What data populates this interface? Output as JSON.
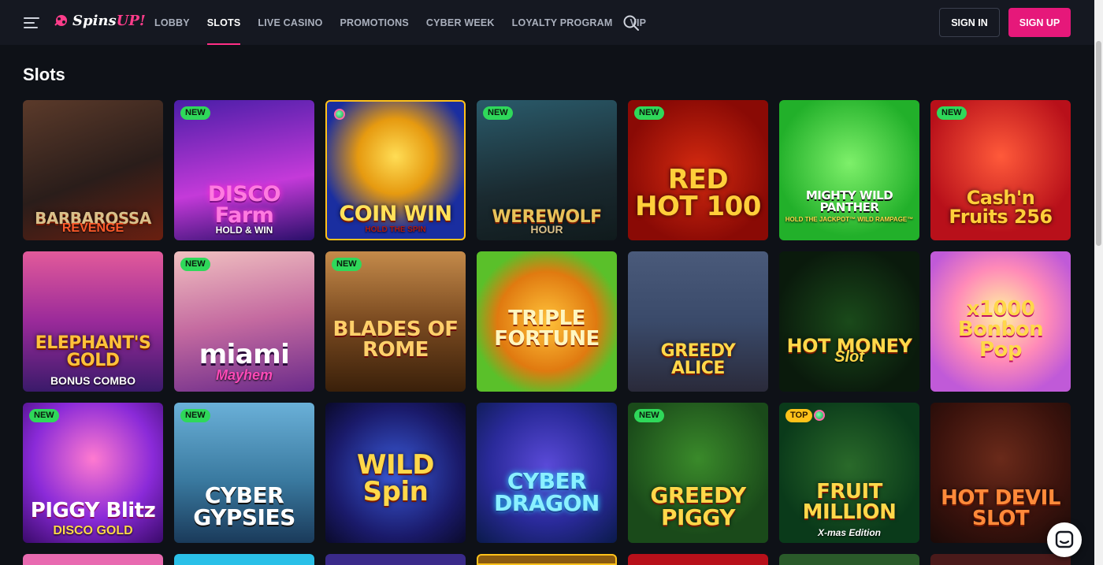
{
  "header": {
    "logo_text": "Spins",
    "logo_accent": "UP!",
    "nav": [
      "LOBBY",
      "SLOTS",
      "LIVE CASINO",
      "PROMOTIONS",
      "CYBER WEEK",
      "LOYALTY PROGRAM",
      "VIP"
    ],
    "active_nav": "SLOTS",
    "signin_label": "SIGN IN",
    "signup_label": "SIGN UP"
  },
  "page": {
    "title": "Slots"
  },
  "games": [
    {
      "name": "BARBAROSSA",
      "sub": "REVENGE",
      "badge": ""
    },
    {
      "name": "DISCO Farm",
      "sub": "HOLD & WIN",
      "badge": "NEW"
    },
    {
      "name": "COIN WIN",
      "sub": "HOLD THE SPIN",
      "badge": ""
    },
    {
      "name": "WEREWOLF",
      "sub": "HOUR",
      "badge": "NEW"
    },
    {
      "name": "RED HOT 100",
      "sub": "",
      "badge": "NEW"
    },
    {
      "name": "MIGHTY WILD PANTHER",
      "sub": "HOLD THE JACKPOT™ WILD RAMPAGE™",
      "badge": ""
    },
    {
      "name": "Cash'n Fruits 256",
      "sub": "",
      "badge": "NEW"
    },
    {
      "name": "ELEPHANT'S GOLD",
      "sub": "BONUS COMBO",
      "badge": ""
    },
    {
      "name": "miami",
      "sub": "Mayhem",
      "badge": "NEW"
    },
    {
      "name": "BLADES OF ROME",
      "sub": "",
      "badge": "NEW"
    },
    {
      "name": "TRIPLE FORTUNE",
      "sub": "",
      "badge": ""
    },
    {
      "name": "GREEDY ALICE",
      "sub": "",
      "badge": ""
    },
    {
      "name": "HOT MONEY",
      "sub": "Slot",
      "badge": ""
    },
    {
      "name": "x1000 Bonbon Pop",
      "sub": "",
      "badge": ""
    },
    {
      "name": "PIGGY Blitz",
      "sub": "DISCO GOLD",
      "badge": "NEW"
    },
    {
      "name": "CYBER GYPSIES",
      "sub": "",
      "badge": "NEW"
    },
    {
      "name": "WILD Spin",
      "sub": "",
      "badge": ""
    },
    {
      "name": "CYBER DRAGON",
      "sub": "",
      "badge": ""
    },
    {
      "name": "GREEDY PIGGY",
      "sub": "",
      "badge": "NEW"
    },
    {
      "name": "FRUIT MILLION",
      "sub": "X-mas Edition",
      "badge": "TOP"
    },
    {
      "name": "HOT DEVIL SLOT",
      "sub": "",
      "badge": ""
    }
  ],
  "colors": {
    "accent": "#e6187a",
    "new_badge": "#2fd85a",
    "top_badge": "#ffc21a",
    "background": "#0e1117"
  }
}
